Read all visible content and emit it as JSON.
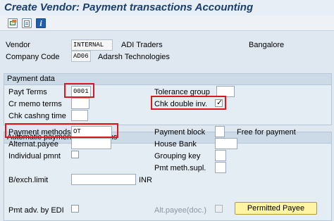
{
  "title": "Create Vendor: Payment transactions Accounting",
  "toolbar": {
    "icons": [
      "save-icon",
      "document-icon",
      "info-icon"
    ],
    "info_glyph": "i"
  },
  "header": {
    "vendor_label": "Vendor",
    "vendor_value": "INTERNAL",
    "vendor_name": "ADI Traders",
    "vendor_city": "Bangalore",
    "company_code_label": "Company Code",
    "company_code_value": "AD06",
    "company_name": "Adarsh Technologies"
  },
  "payment_data": {
    "title": "Payment data",
    "payt_terms_label": "Payt Terms",
    "payt_terms_value": "0001",
    "tolerance_group_label": "Tolerance group",
    "tolerance_group_value": "",
    "cr_memo_terms_label": "Cr memo terms",
    "cr_memo_terms_value": "",
    "chk_double_inv_label": "Chk double inv.",
    "chk_double_inv_checked": true,
    "chk_cashng_time_label": "Chk cashng time",
    "chk_cashng_time_value": ""
  },
  "auto_payment": {
    "title": "Automatic payment transactions",
    "payment_methods_label": "Payment methods",
    "payment_methods_value": "OT",
    "payment_block_label": "Payment block",
    "payment_block_value": "",
    "payment_block_text": "Free for payment",
    "alternat_payee_label": "Alternat.payee",
    "alternat_payee_value": "",
    "house_bank_label": "House Bank",
    "house_bank_value": "",
    "individual_pmnt_label": "Individual pmnt",
    "grouping_key_label": "Grouping key",
    "grouping_key_value": "",
    "pmt_meth_supl_label": "Pmt meth.supl.",
    "pmt_meth_supl_value": "",
    "b_exch_limit_label": "B/exch.limit",
    "b_exch_limit_value": "",
    "currency": "INR",
    "pmt_adv_edi_label": "Pmt adv. by EDI",
    "alt_payee_doc_label": "Alt.payee(doc.)",
    "permitted_payee_label": "Permitted Payee",
    "check_mark": "✓"
  }
}
